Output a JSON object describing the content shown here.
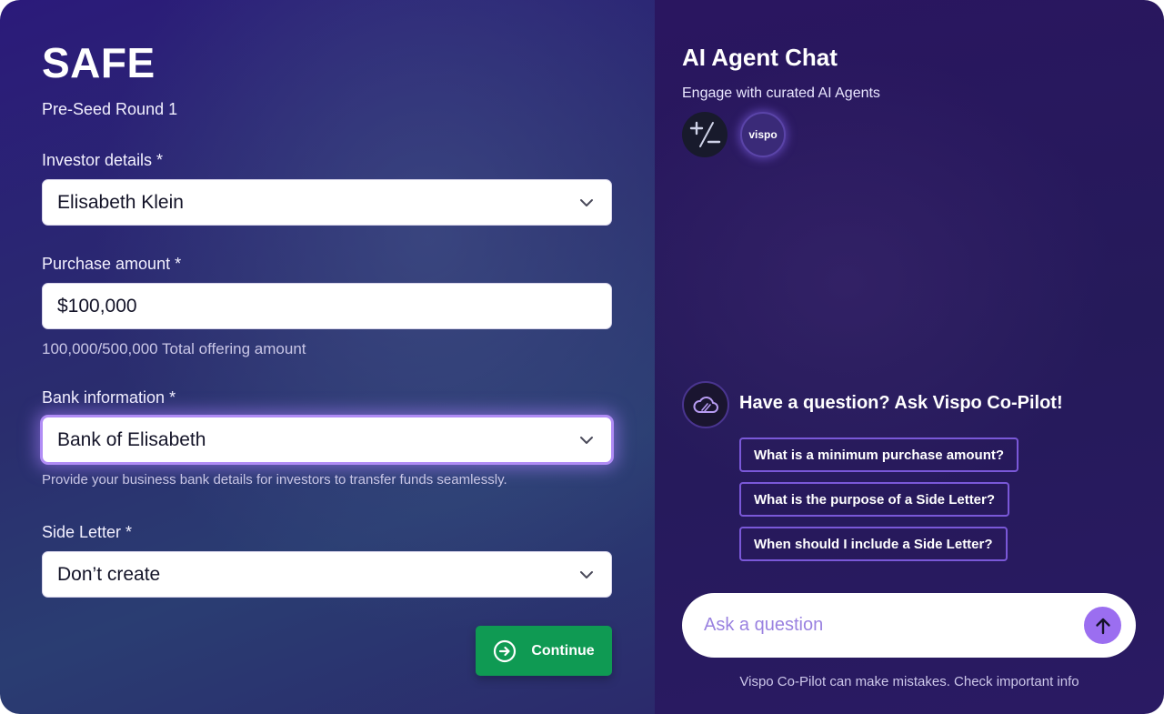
{
  "form": {
    "title": "SAFE",
    "subtitle": "Pre-Seed Round 1",
    "investor": {
      "label": "Investor details *",
      "value": "Elisabeth Klein"
    },
    "purchase": {
      "label": "Purchase amount *",
      "value": "$100,000",
      "helper": "100,000/500,000 Total offering amount",
      "progress": 0.2
    },
    "bank": {
      "label": "Bank information *",
      "value": "Bank of Elisabeth",
      "helper": "Provide your business bank details for investors to transfer funds seamlessly."
    },
    "side_letter": {
      "label": "Side Letter *",
      "value": "Don’t create"
    },
    "continue_label": "Continue"
  },
  "chat": {
    "title": "AI Agent Chat",
    "subtitle": "Engage with curated AI Agents",
    "agents": [
      {
        "name": "calculator-agent",
        "icon": "plus-minus-icon"
      },
      {
        "name": "vispo-agent",
        "label": "vispo"
      }
    ],
    "copilot_title": "Have a question? Ask Vispo Co-Pilot!",
    "suggestions": [
      "What is a minimum purchase amount?",
      "What is the purpose of a Side Letter?",
      "When should I include a Side Letter?"
    ],
    "input_placeholder": "Ask a question",
    "disclaimer": "Vispo Co-Pilot can make mistakes. Check important info"
  },
  "colors": {
    "accent": "#9b6ef0",
    "continue": "#0f9a53",
    "suggestion_border": "#7a58d8"
  }
}
